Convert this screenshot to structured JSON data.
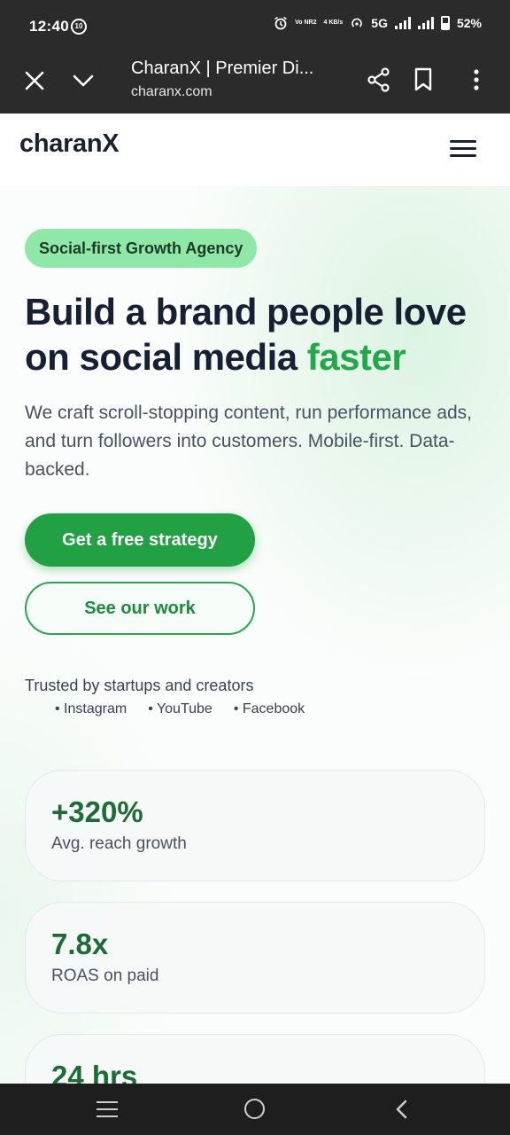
{
  "status_bar": {
    "time": "12:40",
    "notification_badge": "10",
    "net_label": "Vo NR2",
    "speed_label": "4 KB/s",
    "network": "5G",
    "battery": "52%"
  },
  "browser": {
    "title": "CharanX | Premier Di...",
    "url": "charanx.com"
  },
  "site": {
    "logo": "charanX"
  },
  "hero": {
    "badge": "Social-first Growth Agency",
    "title_main": "Build a brand people love on social media ",
    "title_accent": "faster",
    "subtitle": "We craft scroll-stopping content, run performance ads, and turn followers into customers. Mobile-first. Data-backed.",
    "primary_cta": "Get a free strategy",
    "secondary_cta": "See our work"
  },
  "trust": {
    "text": "Trusted by startups and creators",
    "platforms": [
      "Instagram",
      "YouTube",
      "Facebook"
    ]
  },
  "stats": [
    {
      "value": "+320%",
      "label": "Avg. reach growth"
    },
    {
      "value": "7.8x",
      "label": "ROAS on paid"
    },
    {
      "value": "24 hrs",
      "label": ""
    }
  ],
  "colors": {
    "accent": "#22a84a",
    "button": "#22a044",
    "badge": "#8fe8a7",
    "stat_value": "#1d6b35"
  }
}
